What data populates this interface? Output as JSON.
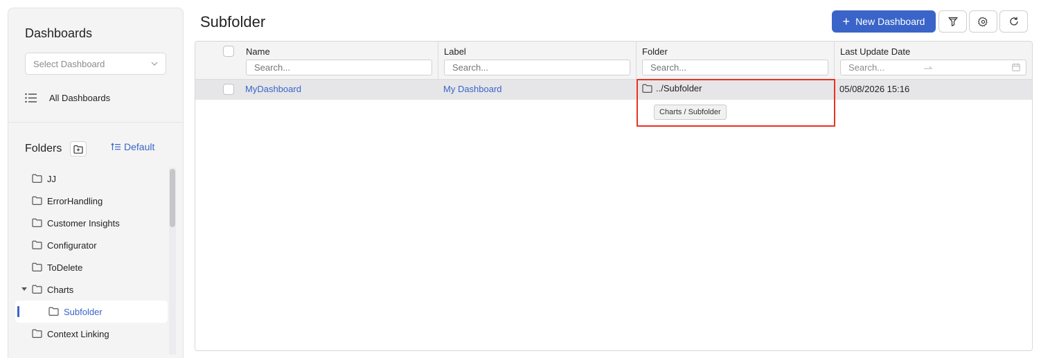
{
  "sidebar": {
    "title": "Dashboards",
    "select_placeholder": "Select Dashboard",
    "all_dashboards_label": "All Dashboards",
    "folders_title": "Folders",
    "sort_label": "Default",
    "folders": [
      {
        "label": "JJ"
      },
      {
        "label": "ErrorHandling"
      },
      {
        "label": "Customer Insights"
      },
      {
        "label": "Configurator"
      },
      {
        "label": "ToDelete"
      },
      {
        "label": "Charts",
        "expanded": true
      },
      {
        "label": "Subfolder",
        "selected": true,
        "parent": "Charts"
      },
      {
        "label": "Context Linking"
      }
    ]
  },
  "header": {
    "title": "Subfolder",
    "new_dashboard_label": "New Dashboard",
    "icons": [
      "filter-icon",
      "settings-icon",
      "refresh-icon"
    ]
  },
  "grid": {
    "columns": [
      {
        "label": "Name",
        "placeholder": "Search..."
      },
      {
        "label": "Label",
        "placeholder": "Search..."
      },
      {
        "label": "Folder",
        "placeholder": "Search..."
      },
      {
        "label": "Last Update Date",
        "placeholder": "Search..."
      }
    ],
    "rows": [
      {
        "name": "MyDashboard",
        "label": "My Dashboard",
        "folder": "../Subfolder",
        "last_update": "05/08/2026 15:16"
      }
    ],
    "tooltip": "Charts / Subfolder"
  },
  "colors": {
    "accent": "#3a64c8",
    "highlight": "#e8321f"
  }
}
